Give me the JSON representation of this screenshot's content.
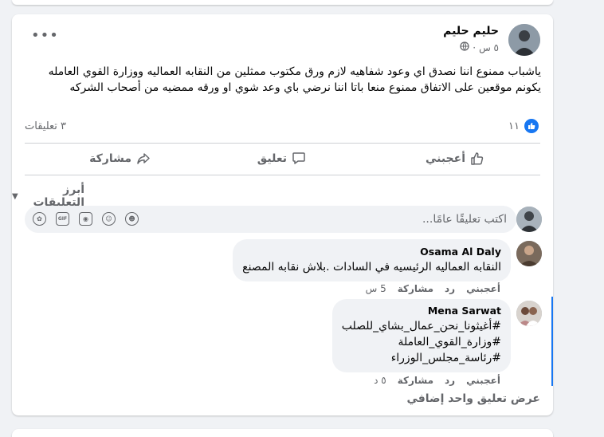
{
  "post": {
    "author": "حليم حليم",
    "time": "٥ س",
    "privacy_icon": "globe-icon",
    "text": "ياشباب ممنوع اننا نصدق اي وعود شفاهيه لازم ورق مكتوب ممثلين من النقابه العماليه ووزارة القوي العامله يكونم موقعين على الاتفاق  ممنوع منعا باتا اننا نرضي باي وعد شوي او ورقه ممضيه من أصحاب الشركه",
    "reactions_count": "١١",
    "comments_count": "٣ تعليقات"
  },
  "actions": {
    "like": "أعجبني",
    "comment": "تعليق",
    "share": "مشاركة"
  },
  "comments_filter": "أبرز التعليقات",
  "composer": {
    "placeholder": "اكتب تعليقًا عامًا..."
  },
  "comments": [
    {
      "name": "Osama Al Daly",
      "text": "النقابه العماليه الرئيسيه في السادات .بلاش نقابه المصنع",
      "like": "أعجبني",
      "reply": "رد",
      "share": "مشاركة",
      "time": "5 س"
    },
    {
      "name": "Mena Sarwat",
      "lines": [
        "#أغيثونا_نحن_عمال_بشاي_للصلب",
        "#وزارة_القوي_العاملة",
        "#رئاسة_مجلس_الوزراء"
      ],
      "like": "أعجبني",
      "reply": "رد",
      "share": "مشاركة",
      "time": "٥ د"
    }
  ],
  "more_replies": "عرض تعليق واحد إضافي",
  "colors": {
    "accent": "#1877f2",
    "secondary_text": "#65676b",
    "bubble": "#f0f2f5"
  }
}
